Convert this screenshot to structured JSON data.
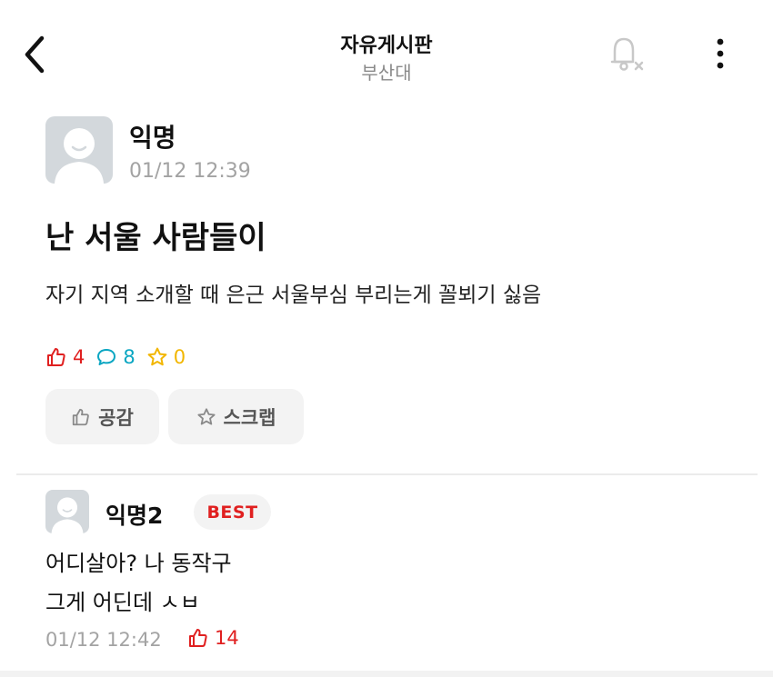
{
  "header": {
    "title": "자유게시판",
    "subtitle": "부산대",
    "back_icon": "chevron-left-icon",
    "bell_icon": "bell-off-icon",
    "more_icon": "more-vertical-icon"
  },
  "post": {
    "author": "익명",
    "time": "01/12 12:39",
    "title": "난 서울 사람들이",
    "body": "자기 지역 소개할 때 은근 서울부심 부리는게 꼴뵈기 싫음",
    "likes": "4",
    "comments": "8",
    "scraps": "0",
    "like_button_label": "공감",
    "scrap_button_label": "스크랩"
  },
  "comment": {
    "author": "익명2",
    "badge": "BEST",
    "lines": [
      "어디살아? 나 동작구",
      "그게 어딘데 ㅅㅂ"
    ],
    "time": "01/12 12:42",
    "likes": "14"
  },
  "colors": {
    "like": "#e02020",
    "comment": "#0aa6c2",
    "scrap": "#f2b600",
    "muted": "#a3a3a3",
    "avatar_bg": "#d3d8dc"
  }
}
